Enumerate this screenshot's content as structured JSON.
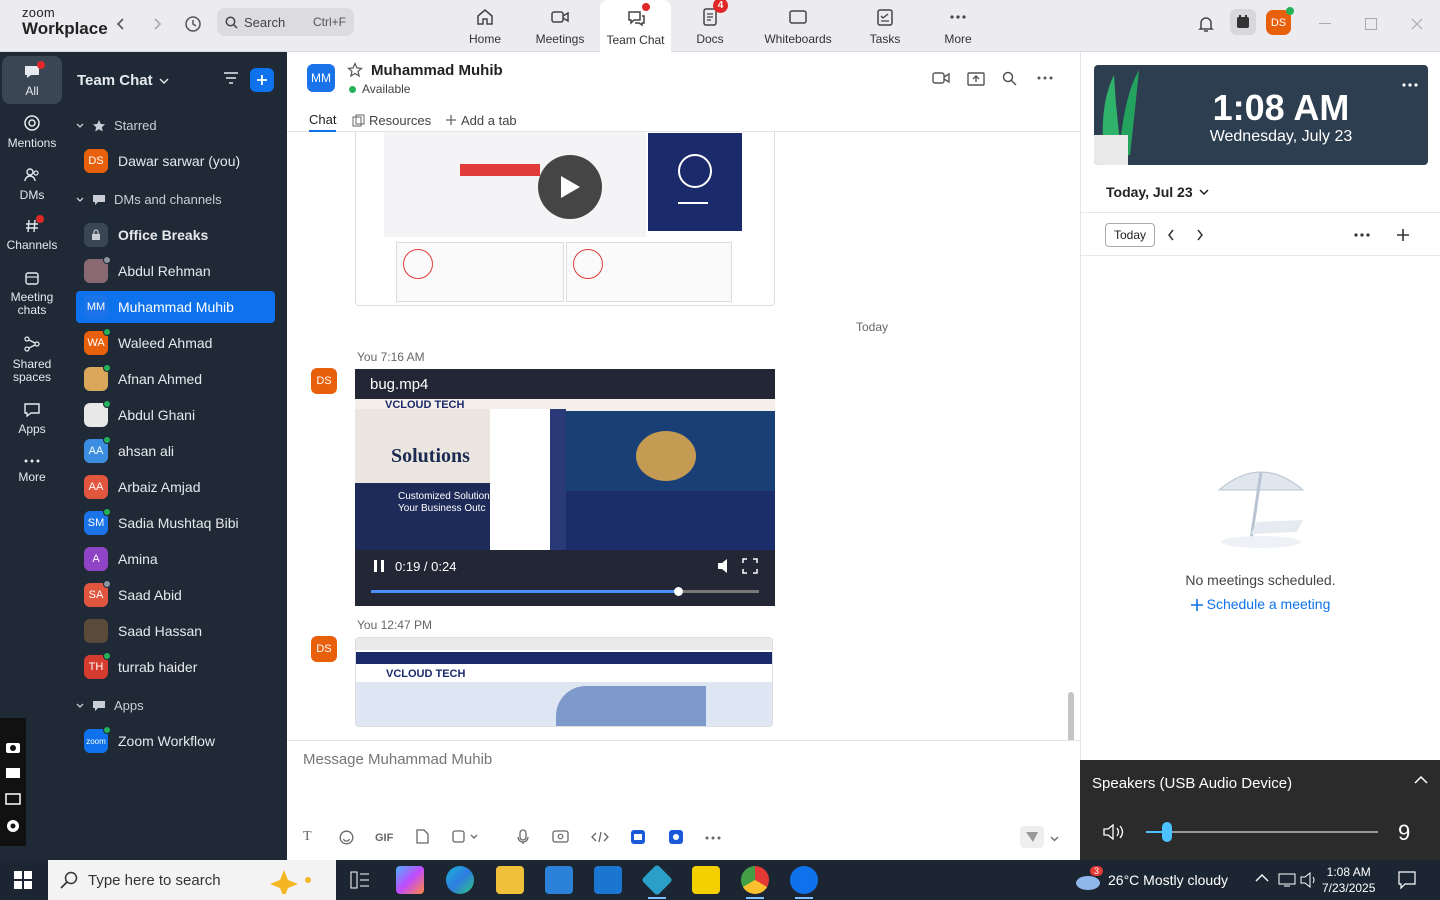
{
  "topbar": {
    "logo_line1": "zoom",
    "logo_line2": "Workplace",
    "search_placeholder": "Search",
    "search_shortcut": "Ctrl+F",
    "avatar_initials": "DS",
    "nav": [
      {
        "label": "Home",
        "icon": "home-icon"
      },
      {
        "label": "Meetings",
        "icon": "video-icon"
      },
      {
        "label": "Team Chat",
        "icon": "chat-icon",
        "active": true
      },
      {
        "label": "Docs",
        "icon": "docs-icon",
        "badge": "4"
      },
      {
        "label": "Whiteboards",
        "icon": "whiteboard-icon"
      },
      {
        "label": "Tasks",
        "icon": "tasks-icon"
      },
      {
        "label": "More",
        "icon": "more-icon"
      }
    ]
  },
  "rail": [
    {
      "label": "All",
      "icon": "chat-bubble-icon"
    },
    {
      "label": "Mentions",
      "icon": "at-icon"
    },
    {
      "label": "DMs",
      "icon": "people-icon"
    },
    {
      "label": "Channels",
      "icon": "hash-icon"
    },
    {
      "label": "Meeting chats",
      "icon": "calendar-icon"
    },
    {
      "label": "Shared spaces",
      "icon": "share-icon"
    },
    {
      "label": "Apps",
      "icon": "apps-icon"
    },
    {
      "label": "More",
      "icon": "ellipsis-icon"
    }
  ],
  "sidebar": {
    "title": "Team Chat",
    "starred_label": "Starred",
    "starred_item": {
      "initials": "DS",
      "name": "Dawar sarwar (you)",
      "color": "#e8600c"
    },
    "dms_label": "DMs and channels",
    "items": [
      {
        "initials": "",
        "name": "Office Breaks",
        "color": "#3a4654",
        "bold": true
      },
      {
        "initials": "AR",
        "name": "Abdul Rehman",
        "color": "#8a6a72"
      },
      {
        "initials": "MM",
        "name": "Muhammad Muhib",
        "color": "#1a73e8",
        "selected": true
      },
      {
        "initials": "WA",
        "name": "Waleed Ahmad",
        "color": "#e8600c"
      },
      {
        "initials": "AF",
        "name": "Afnan Ahmed",
        "color": "#d9a65a"
      },
      {
        "initials": "AG",
        "name": "Abdul Ghani",
        "color": "#e8e8e8"
      },
      {
        "initials": "AA",
        "name": "ahsan ali",
        "color": "#3a8de0"
      },
      {
        "initials": "AA",
        "name": "Arbaiz Amjad",
        "color": "#e2553f"
      },
      {
        "initials": "SM",
        "name": "Sadia Mushtaq Bibi",
        "color": "#1a73e8"
      },
      {
        "initials": "A",
        "name": "Amina",
        "color": "#8e44c5"
      },
      {
        "initials": "SA",
        "name": "Saad Abid",
        "color": "#e2553f"
      },
      {
        "initials": "SH",
        "name": "Saad Hassan",
        "color": "#5a4a3a"
      },
      {
        "initials": "TH",
        "name": "turrab haider",
        "color": "#d63b2f"
      }
    ],
    "apps_label": "Apps",
    "apps_item": {
      "initials": "zoom",
      "name": "Zoom Workflow",
      "color": "#0e72ed"
    }
  },
  "chat": {
    "contact_initials": "MM",
    "contact_name": "Muhammad Muhib",
    "status": "Available",
    "tabs": [
      "Chat",
      "Resources",
      "Add a tab"
    ],
    "date_divider": "Today",
    "messages": [
      {
        "sender": "You",
        "time": "7:16 AM",
        "avatar": "DS"
      },
      {
        "sender": "You",
        "time": "12:47 PM",
        "avatar": "DS"
      }
    ],
    "video": {
      "filename": "bug.mp4",
      "current": "0:19",
      "duration": "0:24",
      "progress": 0.79,
      "frame_brand": "VCLOUD TECH",
      "frame_heading": "Solutions",
      "frame_sub1": "Customized Solution",
      "frame_sub2": "Your Business Outc"
    },
    "shot2_brand": "VCLOUD TECH",
    "composer_placeholder": "Message Muhammad Muhib",
    "tools": {
      "text": "T",
      "gif": "GIF"
    }
  },
  "right_panel": {
    "time": "1:08 AM",
    "date": "Wednesday, July 23",
    "day_heading": "Today, Jul 23",
    "today_button": "Today",
    "empty_text": "No meetings scheduled.",
    "schedule_link": "Schedule a meeting"
  },
  "speaker": {
    "device": "Speakers (USB Audio Device)",
    "value": "9",
    "level": 0.09
  },
  "taskbar": {
    "search_placeholder": "Type here to search",
    "weather_badge": "3",
    "weather": "26°C  Mostly cloudy",
    "time": "1:08 AM",
    "date": "7/23/2025"
  }
}
